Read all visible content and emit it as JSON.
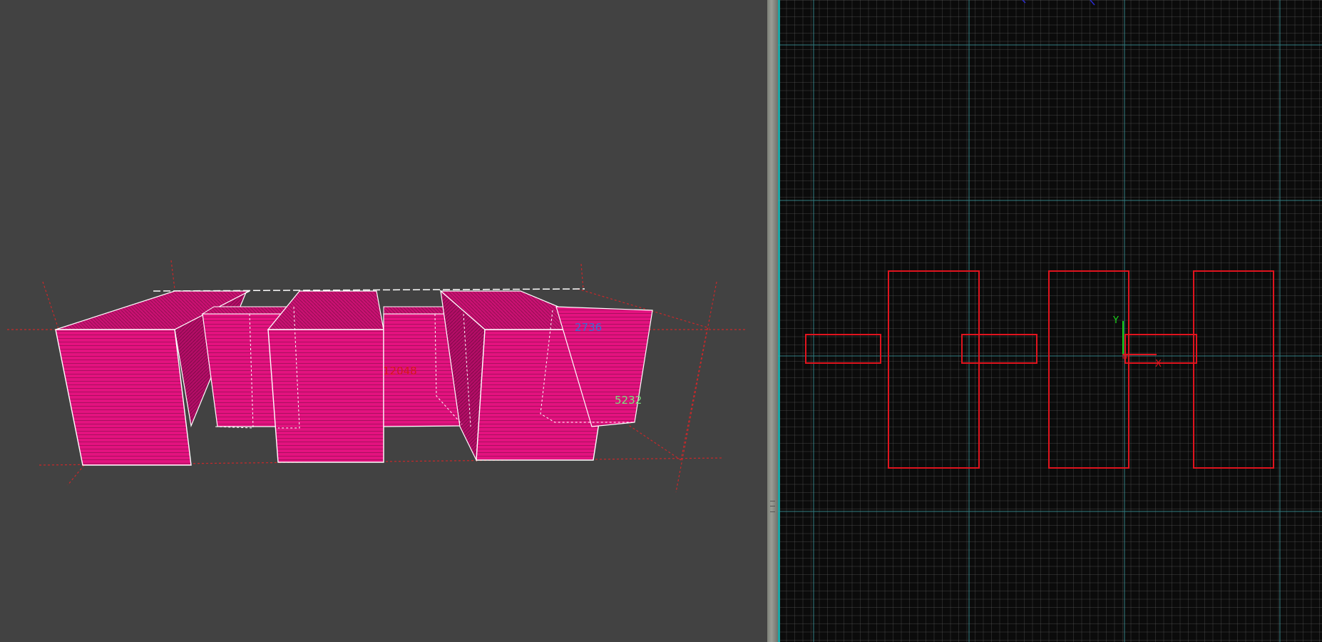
{
  "viewport_3d": {
    "dimensions": {
      "length": "12048",
      "depth": "2736",
      "height": "5232"
    },
    "colors": {
      "fill": "#e3127f",
      "edge": "#ffffff",
      "length_label": "#d41a1a",
      "depth_label": "#3b6fd4",
      "height_label": "#7fe07f",
      "background": "#424242"
    }
  },
  "viewport_2d": {
    "axis": {
      "y_label": "Y",
      "x_label": "X"
    },
    "colors": {
      "outline": "#e0141e",
      "major_grid": "#3fa3a8",
      "y_axis": "#19d419",
      "x_axis": "#e0141e",
      "background": "#0b0b0b"
    }
  }
}
